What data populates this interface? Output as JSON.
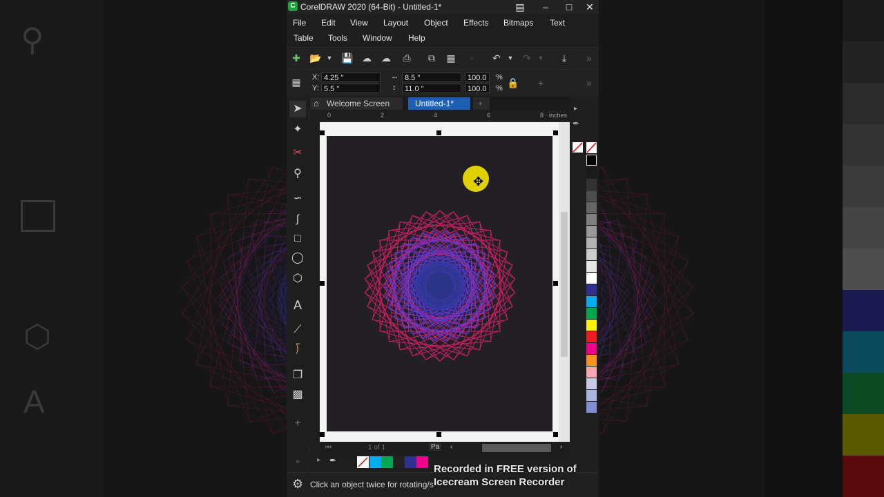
{
  "window": {
    "title": "CorelDRAW 2020 (64-Bit) - Untitled-1*",
    "logo_letter": "C"
  },
  "menu": {
    "row1": [
      "File",
      "Edit",
      "View",
      "Layout",
      "Object",
      "Effects",
      "Bitmaps",
      "Text"
    ],
    "row2": [
      "Table",
      "Tools",
      "Window",
      "Help"
    ]
  },
  "properties": {
    "x_label": "X:",
    "x_value": "4.25 \"",
    "y_label": "Y:",
    "y_value": "5.5 \"",
    "width_value": "8.5 \"",
    "height_value": "11.0 \"",
    "scale_w": "100.0",
    "scale_h": "100.0",
    "pct": "%"
  },
  "tabs": {
    "welcome": "Welcome Screen",
    "active": "Untitled-1*",
    "add": "+"
  },
  "ruler": {
    "units": "inches",
    "ticks": [
      "0",
      "2",
      "4",
      "6",
      "8"
    ]
  },
  "page_nav": {
    "page_of": "1 of 1",
    "page_tab": "Pa"
  },
  "status": {
    "hint": "Click an object twice for rotating/s"
  },
  "watermark": {
    "line1": "Recorded in FREE version of",
    "line2": "Icecream Screen Recorder"
  },
  "palette_colors": [
    "#1a1a1a",
    "#333333",
    "#4d4d4d",
    "#666666",
    "#808080",
    "#999999",
    "#b3b3b3",
    "#cccccc",
    "#e6e6e6",
    "#ffffff",
    "#2e3192",
    "#00aeef",
    "#00a651",
    "#fff200",
    "#ed1c24",
    "#ec008c",
    "#f7941d",
    "#f9a6b7",
    "#c7c9e6",
    "#aab6e0",
    "#7f8fd1"
  ],
  "doc_palette_colors": [
    "#00aeef",
    "#00a651",
    "#222222",
    "#2e3192",
    "#ec008c"
  ],
  "artwork": {
    "outer_color": "#e0206e",
    "inner_color": "#5a3bd6",
    "core_color": "#2f3aa0",
    "dot_color": "#e0d000"
  }
}
